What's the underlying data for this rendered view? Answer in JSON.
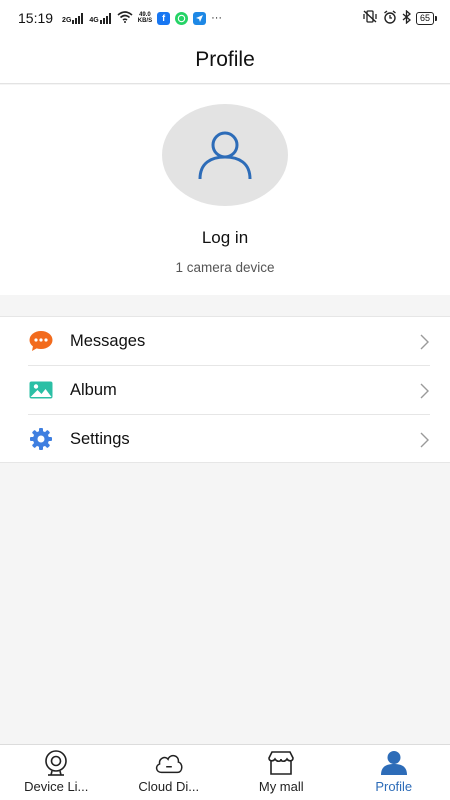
{
  "status_bar": {
    "time": "15:19",
    "signal1_label": "2G",
    "signal2_label": "4G",
    "speed_value": "49.0",
    "speed_unit": "KB/S",
    "more": "···",
    "battery": "65"
  },
  "header": {
    "title": "Profile"
  },
  "profile": {
    "login_label": "Log in",
    "device_count": "1 camera device"
  },
  "menu": {
    "items": [
      {
        "label": "Messages",
        "icon": "chat-bubble-icon",
        "color": "#f26b1d"
      },
      {
        "label": "Album",
        "icon": "picture-icon",
        "color": "#2bbfa5"
      },
      {
        "label": "Settings",
        "icon": "gear-icon",
        "color": "#3f7fe0"
      }
    ]
  },
  "bottom_nav": {
    "items": [
      {
        "label": "Device Li...",
        "icon": "camera-icon"
      },
      {
        "label": "Cloud Di...",
        "icon": "cloud-icon"
      },
      {
        "label": "My mall",
        "icon": "store-icon"
      },
      {
        "label": "Profile",
        "icon": "person-icon",
        "active": true
      }
    ]
  },
  "colors": {
    "accent": "#2d6cb8",
    "background": "#f5f5f5"
  }
}
